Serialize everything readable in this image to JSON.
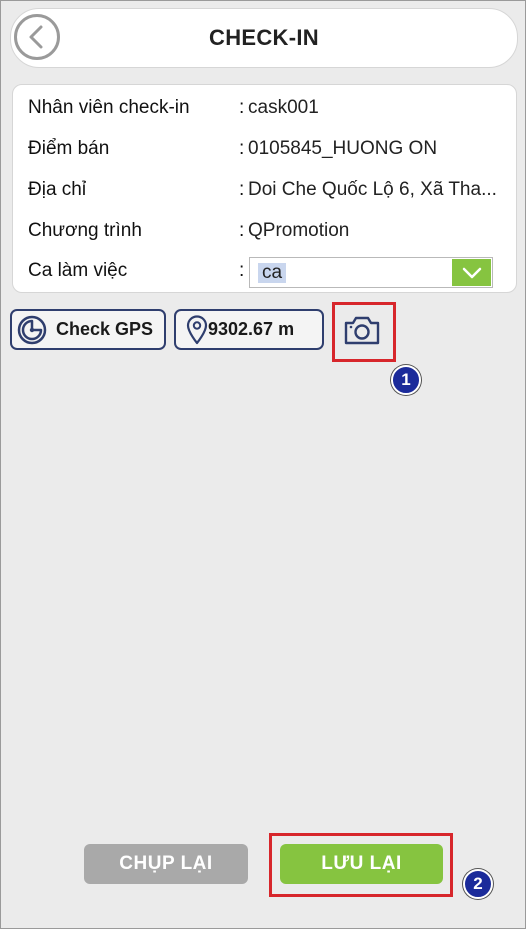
{
  "header": {
    "title": "CHECK-IN",
    "back_icon": "chevron-left-icon"
  },
  "info": {
    "rows": [
      {
        "label": "Nhân viên check-in",
        "colon": ":",
        "value": "cask001"
      },
      {
        "label": "Điểm bán",
        "colon": ":",
        "value": "0105845_HUONG ON"
      },
      {
        "label": "Địa chỉ",
        "colon": ":",
        "value": "Doi Che Quốc Lộ 6, Xã Tha..."
      },
      {
        "label": "Chương trình",
        "colon": ":",
        "value": "QPromotion"
      }
    ],
    "shift": {
      "label": "Ca làm việc",
      "colon": ":",
      "selected": "ca"
    }
  },
  "tools": {
    "check_gps_label": "Check GPS",
    "distance": "9302.67 m",
    "camera_icon": "camera-icon"
  },
  "annotations": {
    "badge1": "1",
    "badge2": "2"
  },
  "actions": {
    "retake_label": "CHỤP LẠI",
    "save_label": "LƯU LẠI"
  },
  "colors": {
    "accent_green": "#86c440",
    "nav_blue": "#2f3e6e",
    "highlight_red": "#d7262b",
    "badge_blue": "#1b2b9a",
    "disabled_gray": "#a9a9a9"
  }
}
